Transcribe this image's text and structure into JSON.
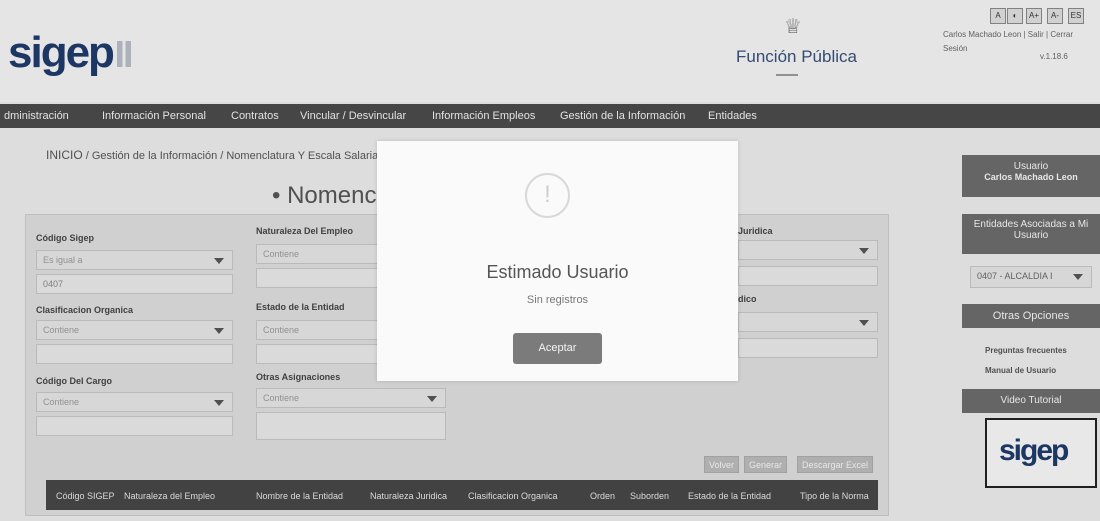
{
  "header": {
    "logo_text": "sigep",
    "org_name": "Función Pública",
    "accessibility_buttons": [
      "A",
      "◐",
      "A+",
      "A-",
      "ES"
    ],
    "user_line1": "Carlos Machado Leon | Salir | Cerrar",
    "user_line2": "Sesión",
    "version": "v.1.18.6"
  },
  "nav": {
    "items": [
      "dministración",
      "Información Personal",
      "Contratos",
      "Vincular / Desvincular",
      "Información Empleos",
      "Gestión de la Información",
      "Entidades"
    ]
  },
  "breadcrumb": {
    "home": "INICIO",
    "path": " / Gestión de la Información / Nomenclatura Y Escala Salarial"
  },
  "page": {
    "title": "• Nomenc"
  },
  "form": {
    "codigo_sigep": {
      "label": "Código Sigep",
      "operator": "Es igual a",
      "value": "0407"
    },
    "naturaleza_empleo": {
      "label": "Naturaleza Del Empleo",
      "operator": "Contiene"
    },
    "naturaleza_juridica": {
      "label": "Juridica"
    },
    "clasificacion": {
      "label": "Clasificacion Organica",
      "operator": "Contiene"
    },
    "estado_entidad": {
      "label": "Estado de la Entidad",
      "operator": "Contiene"
    },
    "tipo_norma": {
      "label": "dico"
    },
    "codigo_cargo": {
      "label": "Código Del Cargo",
      "operator": "Contiene"
    },
    "otras_asignaciones": {
      "label": "Otras Asignaciones",
      "operator": "Contiene"
    },
    "buttons": {
      "volver": "Volver",
      "generar": "Generar",
      "descargar": "Descargar Excel"
    }
  },
  "table": {
    "columns": [
      "Código SIGEP",
      "Naturaleza del Empleo",
      "Nombre de la Entidad",
      "Naturaleza Juridica",
      "Clasificacion Organica",
      "Orden",
      "Suborden",
      "Estado de la Entidad",
      "Tipo de la Norma"
    ]
  },
  "sidebar": {
    "usuario_title": "Usuario",
    "usuario_name": "Carlos Machado Leon",
    "entidades_title": "Entidades Asociadas a Mi Usuario",
    "entidad_selected": "0407 - ALCALDIA I",
    "otras_title": "Otras Opciones",
    "links": [
      "Preguntas frecuentes",
      "Manual de Usuario"
    ],
    "video_title": "Video Tutorial",
    "video_logo": "sigep"
  },
  "modal": {
    "icon": "!",
    "title": "Estimado Usuario",
    "message": "Sin registros",
    "button": "Aceptar"
  },
  "colors": {
    "navbar": "#4a4a4a",
    "logo": "#1f3a6b",
    "modal_button": "#7b7b7b"
  }
}
